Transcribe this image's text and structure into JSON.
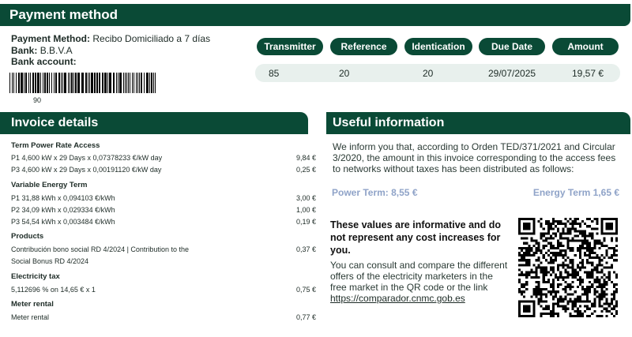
{
  "payment": {
    "title": "Payment method",
    "method_label": "Payment Method:",
    "method_value": "Recibo Domiciliado a 7 días",
    "bank_label": "Bank:",
    "bank_value": "B.B.V.A",
    "account_label": "Bank account:",
    "barcode_number": "90",
    "columns": [
      "Transmitter",
      "Reference",
      "Identication",
      "Due Date",
      "Amount"
    ],
    "values": [
      "85",
      "20",
      "20",
      "29/07/2025",
      "19,57 €"
    ]
  },
  "invoice": {
    "title": "Invoice details",
    "sections": [
      {
        "title": "Term Power Rate Access",
        "lines": [
          {
            "text": "P1 4,600 kW x 29 Days x 0,07378233 €/kW day",
            "amount": "9,84 €"
          },
          {
            "text": "P3 4,600 kW x 29 Days x 0,00191120 €/kW day",
            "amount": "0,25 €"
          }
        ]
      },
      {
        "title": "Variable Energy Term",
        "lines": [
          {
            "text": "P1 31,88 kWh x 0,094103 €/kWh",
            "amount": "3,00 €"
          },
          {
            "text": "P2 34,09 kWh x 0,029334 €/kWh",
            "amount": "1,00 €"
          },
          {
            "text": "P3 54,54 kWh x 0,003484 €/kWh",
            "amount": "0,19 €"
          }
        ]
      },
      {
        "title": "Products",
        "lines": [
          {
            "text": "Contribución bono social RD 4/2024 | Contribution to the",
            "amount": "0,37 €"
          },
          {
            "text": "Social Bonus RD 4/2024",
            "amount": ""
          }
        ]
      },
      {
        "title": "Electricity tax",
        "lines": [
          {
            "text": "5,112696 % on 14,65 € x 1",
            "amount": "0,75 €"
          }
        ]
      },
      {
        "title": "Meter rental",
        "lines": [
          {
            "text": "Meter rental",
            "amount": "0,77 €"
          }
        ]
      }
    ]
  },
  "useful": {
    "title": "Useful information",
    "text": "We inform you that, according to Orden TED/371/2021 and Circular 3/2020, the amount in this invoice corresponding to the access fees to  networks without taxes has been distributed as follows:",
    "power_term": "Power Term: 8,55 €",
    "energy_term": "Energy Term 1,65 €",
    "bold_note": "These values are informative and do not represent any cost increases for you.",
    "consult_text": "You can consult and compare the different offers of the electricity marketers in the free market in the QR code or the link",
    "link": "https://comparador.cnmc.gob.es"
  },
  "colors": {
    "brand_green": "#0a4a36",
    "term_blue": "#8fa3c8",
    "row_bg": "#e8f0ed"
  },
  "icons": [
    "barcode",
    "qr-code"
  ]
}
